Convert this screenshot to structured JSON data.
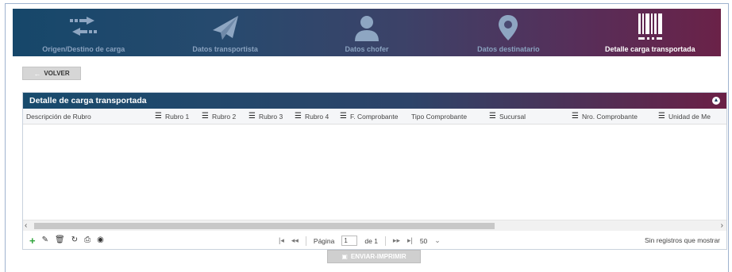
{
  "steps": [
    {
      "label": "Origen/Destino de carga",
      "icon": "arrows-exchange-icon",
      "active": false
    },
    {
      "label": "Datos transportista",
      "icon": "paper-plane-icon",
      "active": false
    },
    {
      "label": "Datos chofer",
      "icon": "user-icon",
      "active": false
    },
    {
      "label": "Datos destinatario",
      "icon": "map-marker-icon",
      "active": false
    },
    {
      "label": "Detalle carga transportada",
      "icon": "barcode-icon",
      "active": true
    }
  ],
  "back_button": {
    "label": "VOLVER",
    "icon": "arrow-left-icon"
  },
  "panel": {
    "title": "Detalle de carga transportada",
    "toggle_icon": "chevron-circle-icon",
    "columns": [
      {
        "label": "Descripción de Rubro"
      },
      {
        "label": "Rubro 1"
      },
      {
        "label": "Rubro 2"
      },
      {
        "label": "Rubro 3"
      },
      {
        "label": "Rubro 4"
      },
      {
        "label": "F. Comprobante"
      },
      {
        "label": "Tipo Comprobante"
      },
      {
        "label": "Sucursal"
      },
      {
        "label": "Nro. Comprobante"
      },
      {
        "label": "Unidad de Me"
      }
    ],
    "rows": []
  },
  "toolbar": {
    "add_icon": "plus-icon",
    "edit_icon": "edit-icon",
    "delete_icon": "trash-icon",
    "refresh_icon": "refresh-icon",
    "print_icon": "print-icon",
    "view_icon": "eye-icon"
  },
  "pager": {
    "page_label": "Página",
    "page_value": "1",
    "of_label": "de 1",
    "page_size": "50",
    "empty_text": "Sin registros que mostrar"
  },
  "submit_button": {
    "label": "ENVIAR-IMPRIMIR",
    "icon": "save-icon"
  },
  "colors": {
    "header_start": "#16476a",
    "header_end": "#6a2248",
    "inactive_label": "#8aa2bf",
    "add_green": "#2ea33a"
  }
}
